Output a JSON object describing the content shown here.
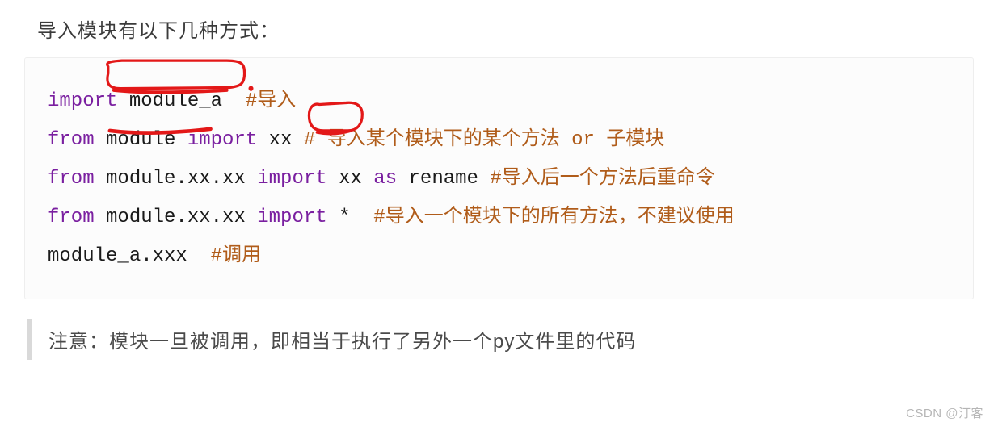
{
  "intro": "导入模块有以下几种方式：",
  "code": {
    "line1": {
      "kw_import": "import",
      "module": "module_a",
      "comment": "#导入"
    },
    "line2": {
      "kw_from": "from",
      "module": "module",
      "kw_import": "import",
      "name": "xx",
      "comment": "# 导入某个模块下的某个方法 or 子模块"
    },
    "line3": {
      "kw_from": "from",
      "module": "module.xx.xx",
      "kw_import": "import",
      "name": "xx",
      "kw_as": "as",
      "rename": "rename",
      "comment": "#导入后一个方法后重命令"
    },
    "line4": {
      "kw_from": "from",
      "module": "module.xx.xx",
      "kw_import": "import",
      "star": "*",
      "comment": "#导入一个模块下的所有方法，不建议使用"
    },
    "line5": {
      "call": "module_a.xxx",
      "comment": "#调用"
    }
  },
  "note": "注意：模块一旦被调用，即相当于执行了另外一个py文件里的代码",
  "watermark": "CSDN @汀客",
  "annotations": {
    "circle1_target": "module_a",
    "circle2_target": "xx",
    "underline_target": "module",
    "color": "#e31818"
  }
}
